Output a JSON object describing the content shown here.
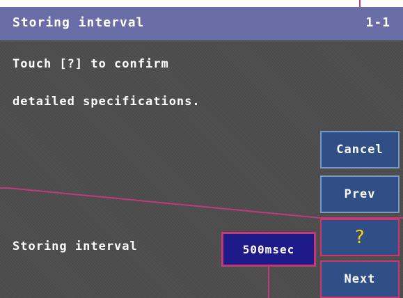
{
  "title_bar": {
    "title": "Storing interval",
    "page": "1-1"
  },
  "message": {
    "line1": "Touch [?] to confirm",
    "line2": "detailed specifications."
  },
  "buttons": {
    "cancel": "Cancel",
    "prev": "Prev",
    "help": "?",
    "next": "Next"
  },
  "setting": {
    "label": "Storing interval",
    "value": "500msec"
  }
}
